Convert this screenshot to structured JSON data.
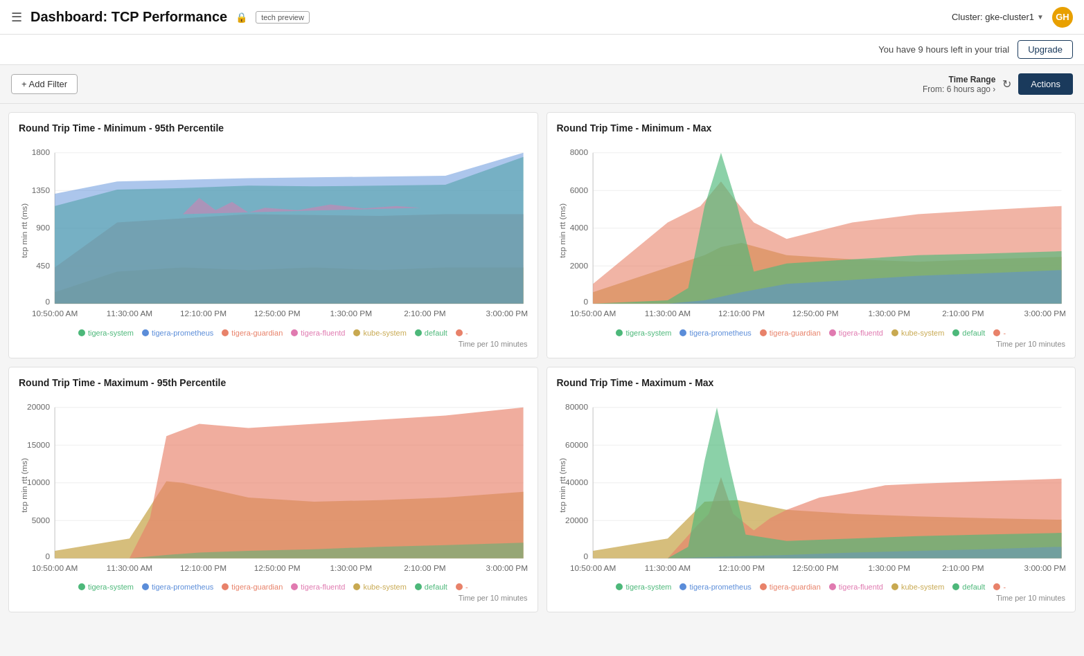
{
  "header": {
    "title": "Dashboard: TCP Performance",
    "tech_preview": "tech preview",
    "cluster_label": "Cluster: gke-cluster1",
    "user_initials": "GH"
  },
  "trial_banner": {
    "text": "You have 9 hours left in your trial",
    "upgrade_label": "Upgrade"
  },
  "toolbar": {
    "add_filter_label": "+ Add Filter",
    "time_range_label": "Time Range",
    "time_range_value": "From: 6 hours ago ›",
    "actions_label": "Actions"
  },
  "charts": [
    {
      "id": "chart1",
      "title": "Round Trip Time - Minimum - 95th Percentile",
      "y_axis_label": "tcp min rtt (ms)",
      "y_max": 1800,
      "y_ticks": [
        0,
        450,
        900,
        1350,
        1800
      ],
      "x_ticks": [
        "10:50:00 AM",
        "11:30:00 AM",
        "12:10:00 PM",
        "12:50:00 PM",
        "1:30:00 PM",
        "2:10:00 PM",
        "3:00:00 PM"
      ],
      "footer": "Time per 10 minutes",
      "legend": [
        {
          "label": "tigera-system",
          "color": "#4db87a",
          "border": "#4db87a"
        },
        {
          "label": "tigera-prometheus",
          "color": "#5b8dd9",
          "border": "#5b8dd9"
        },
        {
          "label": "tigera-guardian",
          "color": "#e8826a",
          "border": "#e8826a"
        },
        {
          "label": "tigera-fluentd",
          "color": "#e07ab0",
          "border": "#e07ab0"
        },
        {
          "label": "kube-system",
          "color": "#c8a951",
          "border": "#c8a951"
        },
        {
          "label": "default",
          "color": "#4db87a",
          "border": "#4db87a"
        },
        {
          "label": "-",
          "color": "#e8826a",
          "border": "#e8826a"
        }
      ]
    },
    {
      "id": "chart2",
      "title": "Round Trip Time - Minimum - Max",
      "y_axis_label": "tcp min rtt (ms)",
      "y_max": 8000,
      "y_ticks": [
        0,
        2000,
        4000,
        6000,
        8000
      ],
      "x_ticks": [
        "10:50:00 AM",
        "11:30:00 AM",
        "12:10:00 PM",
        "12:50:00 PM",
        "1:30:00 PM",
        "2:10:00 PM",
        "3:00:00 PM"
      ],
      "footer": "Time per 10 minutes",
      "legend": [
        {
          "label": "tigera-system",
          "color": "#4db87a",
          "border": "#4db87a"
        },
        {
          "label": "tigera-prometheus",
          "color": "#5b8dd9",
          "border": "#5b8dd9"
        },
        {
          "label": "tigera-guardian",
          "color": "#e8826a",
          "border": "#e8826a"
        },
        {
          "label": "tigera-fluentd",
          "color": "#e07ab0",
          "border": "#e07ab0"
        },
        {
          "label": "kube-system",
          "color": "#c8a951",
          "border": "#c8a951"
        },
        {
          "label": "default",
          "color": "#4db87a",
          "border": "#4db87a"
        },
        {
          "label": "-",
          "color": "#e8826a",
          "border": "#e8826a"
        }
      ]
    },
    {
      "id": "chart3",
      "title": "Round Trip Time - Maximum - 95th Percentile",
      "y_axis_label": "tcp min rtt (ms)",
      "y_max": 20000,
      "y_ticks": [
        0,
        5000,
        10000,
        15000,
        20000
      ],
      "x_ticks": [
        "10:50:00 AM",
        "11:30:00 AM",
        "12:10:00 PM",
        "12:50:00 PM",
        "1:30:00 PM",
        "2:10:00 PM",
        "3:00:00 PM"
      ],
      "footer": "Time per 10 minutes",
      "legend": [
        {
          "label": "tigera-system",
          "color": "#4db87a",
          "border": "#4db87a"
        },
        {
          "label": "tigera-prometheus",
          "color": "#5b8dd9",
          "border": "#5b8dd9"
        },
        {
          "label": "tigera-guardian",
          "color": "#e8826a",
          "border": "#e8826a"
        },
        {
          "label": "tigera-fluentd",
          "color": "#e07ab0",
          "border": "#e07ab0"
        },
        {
          "label": "kube-system",
          "color": "#c8a951",
          "border": "#c8a951"
        },
        {
          "label": "default",
          "color": "#4db87a",
          "border": "#4db87a"
        },
        {
          "label": "-",
          "color": "#e8826a",
          "border": "#e8826a"
        }
      ]
    },
    {
      "id": "chart4",
      "title": "Round Trip Time - Maximum - Max",
      "y_axis_label": "tcp min rtt (ms)",
      "y_max": 80000,
      "y_ticks": [
        0,
        20000,
        40000,
        60000,
        80000
      ],
      "x_ticks": [
        "10:50:00 AM",
        "11:30:00 AM",
        "12:10:00 PM",
        "12:50:00 PM",
        "1:30:00 PM",
        "2:10:00 PM",
        "3:00:00 PM"
      ],
      "footer": "Time per 10 minutes",
      "legend": [
        {
          "label": "tigera-system",
          "color": "#4db87a",
          "border": "#4db87a"
        },
        {
          "label": "tigera-prometheus",
          "color": "#5b8dd9",
          "border": "#5b8dd9"
        },
        {
          "label": "tigera-guardian",
          "color": "#e8826a",
          "border": "#e8826a"
        },
        {
          "label": "tigera-fluentd",
          "color": "#e07ab0",
          "border": "#e07ab0"
        },
        {
          "label": "kube-system",
          "color": "#c8a951",
          "border": "#c8a951"
        },
        {
          "label": "default",
          "color": "#4db87a",
          "border": "#4db87a"
        },
        {
          "label": "-",
          "color": "#e8826a",
          "border": "#e8826a"
        }
      ]
    }
  ]
}
